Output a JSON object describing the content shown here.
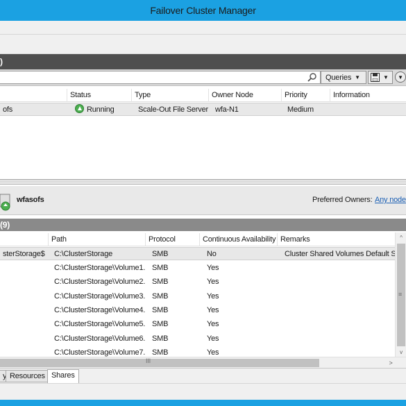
{
  "window": {
    "title": "Failover Cluster Manager"
  },
  "roles_section": {
    "header": ")"
  },
  "search": {
    "placeholder": ""
  },
  "toolbar": {
    "queries_label": "Queries",
    "dropdown_arrow": "▼",
    "expand": "▼"
  },
  "roles_grid": {
    "columns": [
      "",
      "Status",
      "Type",
      "Owner Node",
      "Priority",
      "Information"
    ],
    "rows": [
      {
        "name": "ofs",
        "status": "Running",
        "type": "Scale-Out File Server",
        "owner_node": "wfa-N1",
        "priority": "Medium",
        "information": ""
      }
    ]
  },
  "detail": {
    "role_name": "wfasofs",
    "preferred_owners_label": "Preferred Owners:",
    "preferred_owners_link": "Any node"
  },
  "shares_section": {
    "header": "(9)"
  },
  "shares_grid": {
    "columns": [
      "",
      "Path",
      "Protocol",
      "Continuous Availability",
      "Remarks"
    ],
    "rows": [
      {
        "name": "sterStorage$",
        "path": "C:\\ClusterStorage",
        "protocol": "SMB",
        "ca": "No",
        "remarks": "Cluster Shared Volumes Default Sha"
      },
      {
        "name": "",
        "path": "C:\\ClusterStorage\\Volume1...",
        "protocol": "SMB",
        "ca": "Yes",
        "remarks": ""
      },
      {
        "name": "",
        "path": "C:\\ClusterStorage\\Volume2...",
        "protocol": "SMB",
        "ca": "Yes",
        "remarks": ""
      },
      {
        "name": "",
        "path": "C:\\ClusterStorage\\Volume3...",
        "protocol": "SMB",
        "ca": "Yes",
        "remarks": ""
      },
      {
        "name": "",
        "path": "C:\\ClusterStorage\\Volume4...",
        "protocol": "SMB",
        "ca": "Yes",
        "remarks": ""
      },
      {
        "name": "",
        "path": "C:\\ClusterStorage\\Volume5...",
        "protocol": "SMB",
        "ca": "Yes",
        "remarks": ""
      },
      {
        "name": "",
        "path": "C:\\ClusterStorage\\Volume6...",
        "protocol": "SMB",
        "ca": "Yes",
        "remarks": ""
      },
      {
        "name": "",
        "path": "C:\\ClusterStorage\\Volume7...",
        "protocol": "SMB",
        "ca": "Yes",
        "remarks": ""
      }
    ]
  },
  "scroll": {
    "up": "^",
    "down": "v",
    "right": ">",
    "grip_v": "≡",
    "grip_h": "III"
  },
  "tabs": [
    {
      "label": "y",
      "active": false
    },
    {
      "label": "Resources",
      "active": false
    },
    {
      "label": "Shares",
      "active": true
    }
  ],
  "colors": {
    "titlebar": "#1ba1e2",
    "section_header": "#4f4f4f",
    "link": "#1a5fb4",
    "running": "#4caf50"
  }
}
